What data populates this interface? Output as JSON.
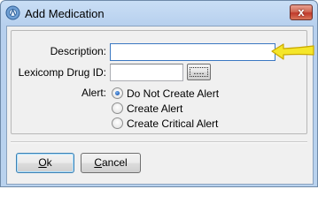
{
  "window": {
    "title": "Add Medication",
    "close_glyph": "x"
  },
  "form": {
    "description_label": "Description:",
    "description_value": "",
    "drug_id_label": "Lexicomp Drug ID:",
    "drug_id_value": "",
    "lookup_button_label": "....",
    "alert_label": "Alert:",
    "alert_options": [
      {
        "label": "Do Not Create Alert",
        "checked": true
      },
      {
        "label": "Create Alert",
        "checked": false
      },
      {
        "label": "Create Critical Alert",
        "checked": false
      }
    ]
  },
  "buttons": {
    "ok_mnemonic": "O",
    "ok_rest": "k",
    "cancel_mnemonic": "C",
    "cancel_rest": "ancel"
  },
  "icons": {
    "app": "app-icon",
    "arrow": "yellow-arrow-annotation-icon"
  },
  "colors": {
    "arrow_fill": "#f5e62a",
    "arrow_stroke": "#c9a800",
    "close_button": "#c0392b"
  }
}
